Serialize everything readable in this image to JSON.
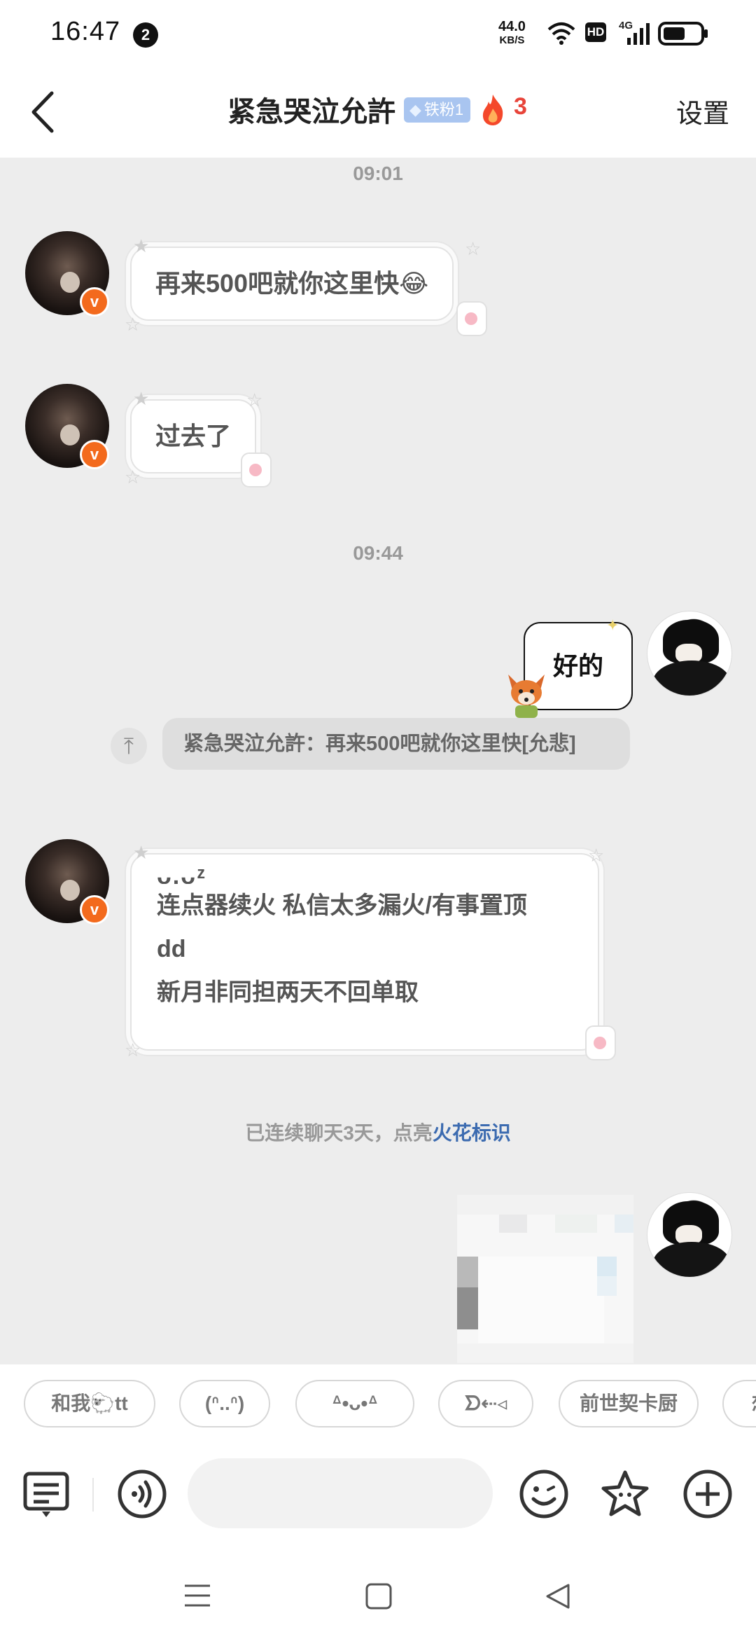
{
  "status_bar": {
    "time": "16:47",
    "notification_count": "2",
    "net_speed": "44.0",
    "net_unit": "KB/S",
    "hd": "HD",
    "signal": "4G"
  },
  "header": {
    "title": "紧急哭泣允許",
    "fan_badge": "铁粉1",
    "fire_count": "3",
    "settings": "设置"
  },
  "messages": {
    "time_1": "09:01",
    "msg_1": "再来500吧就你这里快😂",
    "msg_2": "过去了",
    "time_2": "09:44",
    "reply": "好的",
    "quote": "紧急哭泣允許：再来500吧就你这里快[允悲]",
    "bio_line_0": "ᴗ.ᴗᶻ",
    "bio_line_1": "连点器续火 私信太多漏火/有事置顶",
    "bio_line_2": "dd",
    "bio_line_3": "新月非同担两天不回单取",
    "system_prefix": "已连续聊天3天，点亮",
    "system_link": "火花标识"
  },
  "quick_replies": [
    "和我🐑tt",
    "(ᐢ..ᐢ)",
    "ᐞ•ᴗ•ᐞ",
    "ᗤ⇠◃",
    "前世契卡厨",
    "想"
  ],
  "input": {
    "placeholder": ""
  },
  "colors": {
    "accent_orange": "#f36a1d",
    "fire_red": "#e8443a",
    "link_blue": "#3c6bb0",
    "badge_blue": "#a9c5f0"
  }
}
